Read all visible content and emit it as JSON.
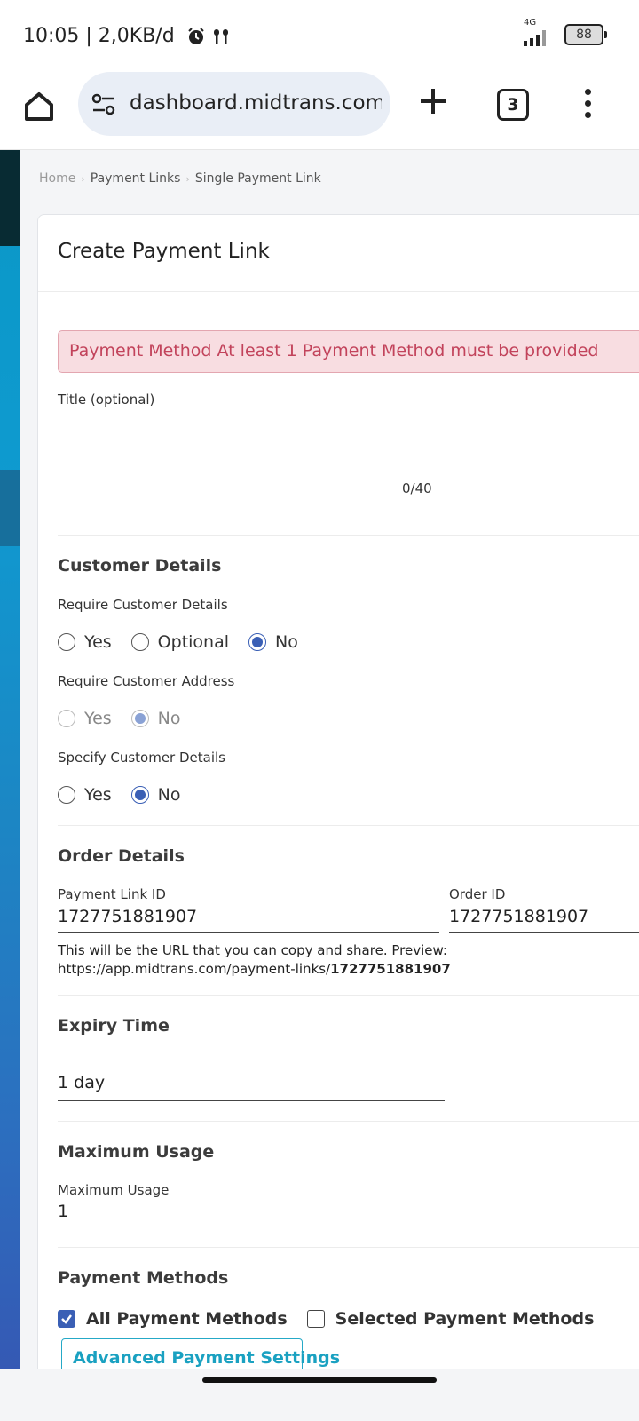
{
  "status_bar": {
    "time": "10:05 | 2,0KB/d",
    "network": "4G",
    "battery": "88"
  },
  "browser": {
    "url": "dashboard.midtrans.com/s",
    "tab_count": "3"
  },
  "breadcrumb": {
    "home": "Home",
    "payment_links": "Payment Links",
    "current": "Single Payment Link"
  },
  "form": {
    "title": "Create Payment Link",
    "alert": "Payment Method At least 1 Payment Method must be provided",
    "title_field": {
      "label": "Title (optional)",
      "value": "",
      "counter": "0/40"
    },
    "customer_details": {
      "heading": "Customer Details",
      "require_details": {
        "label": "Require Customer Details",
        "options": [
          "Yes",
          "Optional",
          "No"
        ],
        "selected": "No"
      },
      "require_address": {
        "label": "Require Customer Address",
        "options": [
          "Yes",
          "No"
        ],
        "selected": "No"
      },
      "specify_details": {
        "label": "Specify Customer Details",
        "options": [
          "Yes",
          "No"
        ],
        "selected": "No"
      }
    },
    "order_details": {
      "heading": "Order Details",
      "payment_link_id_label": "Payment Link ID",
      "payment_link_id": "1727751881907",
      "order_id_label": "Order ID",
      "order_id": "1727751881907",
      "help_line1": "This will be the URL that you can copy and share. Preview:",
      "help_prefix": "https://app.midtrans.com/payment-links/",
      "help_id": "1727751881907"
    },
    "expiry": {
      "heading": "Expiry Time",
      "value": "1 day"
    },
    "maximum_usage": {
      "heading": "Maximum Usage",
      "label": "Maximum Usage",
      "value": "1"
    },
    "payment_methods": {
      "heading": "Payment Methods",
      "all_label": "All Payment Methods",
      "all_checked": true,
      "selected_label": "Selected Payment Methods",
      "selected_checked": false,
      "advanced_button": "Advanced Payment Settings"
    }
  },
  "colors": {
    "accent": "#3a5fb5",
    "alert_text": "#c2435b",
    "alert_bg": "#f8dde1",
    "button_text": "#1aa1c1"
  }
}
